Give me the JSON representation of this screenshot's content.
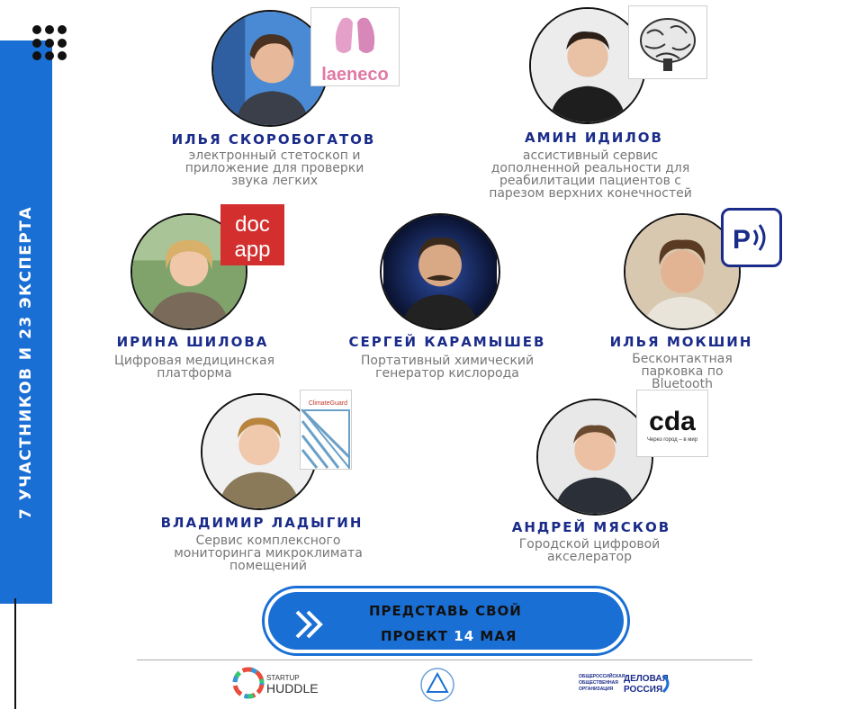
{
  "sidebar": {
    "text": "7 УЧАСТНИКОВ И 23 ЭКСПЕРТА"
  },
  "participants": [
    {
      "name": "ИЛЬЯ СКОРОБОГАТОВ",
      "desc": [
        "электронный стетоскоп и",
        "приложение для проверки",
        "звука легких"
      ],
      "logo_text": "laeneco"
    },
    {
      "name": "АМИН ИДИЛОВ",
      "desc": [
        "ассистивный сервис",
        "дополненной реальности для",
        "реабилитации пациентов с",
        "парезом верхних конечностей"
      ]
    },
    {
      "name": "ИРИНА ШИЛОВА",
      "desc": [
        "Цифровая медицинская",
        "платформа"
      ],
      "logo_text": [
        "doc",
        "app"
      ]
    },
    {
      "name": "СЕРГЕЙ КАРАМЫШЕВ",
      "desc": [
        "Портативный химический",
        "генератор кислорода"
      ]
    },
    {
      "name": "ИЛЬЯ МОКШИН",
      "desc": [
        "Бесконтактная парковка по",
        "Bluetooth"
      ]
    },
    {
      "name": "ВЛАДИМИР ЛАДЫГИН",
      "desc": [
        "Сервис комплексного",
        "мониторинга микроклимата",
        "помещений"
      ],
      "logo_text": "ClimateGuard"
    },
    {
      "name": "АНДРЕЙ МЯСКОВ",
      "desc": [
        "Городской цифровой",
        "акселератор"
      ],
      "logo_text": "cda",
      "logo_sub": "Через город – в мир"
    }
  ],
  "cta": {
    "line1": "ПРЕДСТАВЬ СВОЙ",
    "line2_prefix": "ПРОЕКТ",
    "line2_day": "14",
    "line2_suffix": "МАЯ"
  },
  "footer": {
    "startup_huddle": [
      "STARTUP",
      "HUDDLE"
    ],
    "delovaya_org": [
      "ОБЩЕРОССИЙСКАЯ",
      "ОБЩЕСТВЕННАЯ",
      "ОРГАНИЗАЦИЯ"
    ],
    "delovaya_name": [
      "ДЕЛОВАЯ",
      "РОССИЯ"
    ]
  },
  "colors": {
    "accent": "#1a6fd4",
    "name": "#1a2b8a",
    "desc": "#777777",
    "doc_red": "#d32f2f",
    "laeneco_pink": "#e07aa3"
  }
}
